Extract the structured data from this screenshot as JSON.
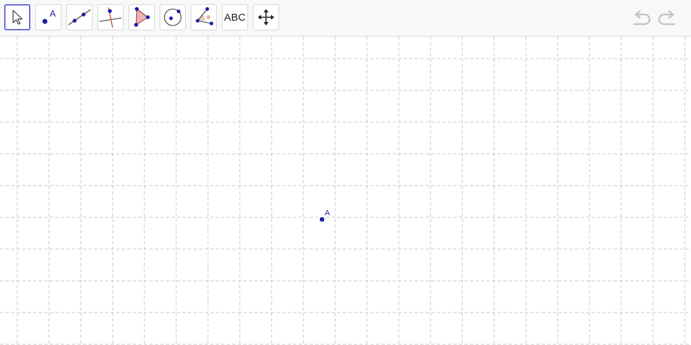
{
  "toolbar": {
    "tools": [
      {
        "id": "move",
        "icon": "cursor-arrow-icon",
        "selected": true
      },
      {
        "id": "point",
        "icon": "point-icon",
        "icon_text": "A"
      },
      {
        "id": "line",
        "icon": "line-through-points-icon"
      },
      {
        "id": "perpendicular",
        "icon": "perpendicular-line-icon"
      },
      {
        "id": "polygon",
        "icon": "polygon-icon"
      },
      {
        "id": "circle",
        "icon": "circle-center-point-icon"
      },
      {
        "id": "angle",
        "icon": "angle-icon",
        "icon_text": "α"
      },
      {
        "id": "text",
        "icon": "text-icon",
        "label": "ABC"
      },
      {
        "id": "move-graphics",
        "icon": "move-graphics-view-icon"
      }
    ],
    "undo_icon": "undo-icon",
    "redo_icon": "redo-icon"
  },
  "graphics": {
    "grid": true,
    "grid_style": "dashed",
    "grid_color": "#c9c9c9",
    "points": [
      {
        "name": "A",
        "label": "A",
        "color": "#1a1aa8"
      }
    ]
  },
  "colors": {
    "accent": "#6b6bd6",
    "point": "#1a1aa8",
    "construction_red": "#c0392b"
  }
}
